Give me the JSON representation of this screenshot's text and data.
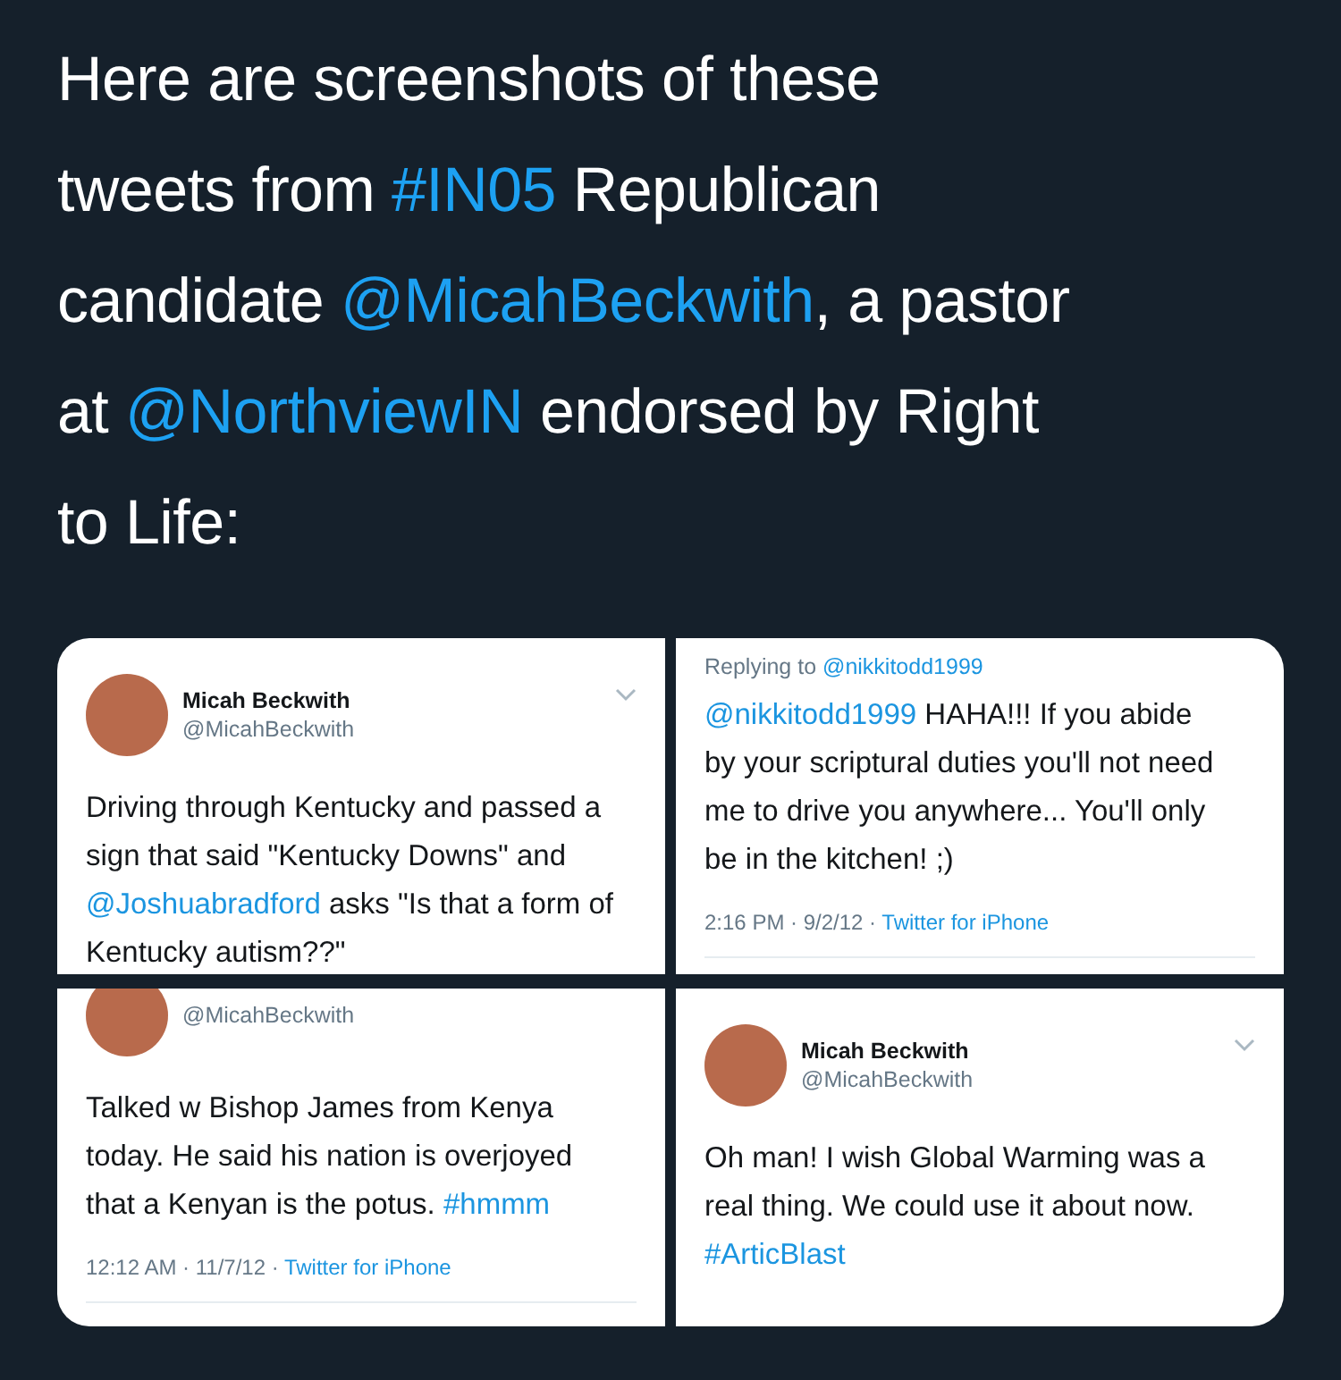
{
  "headline": {
    "lines": [
      [
        {
          "kind": "text",
          "text": "Here are screenshots of these"
        }
      ],
      [
        {
          "kind": "text",
          "text": "tweets from "
        },
        {
          "kind": "link",
          "text": "#IN05"
        },
        {
          "kind": "text",
          "text": " Republican"
        }
      ],
      [
        {
          "kind": "text",
          "text": "candidate "
        },
        {
          "kind": "link",
          "text": "@MicahBeckwith"
        },
        {
          "kind": "text",
          "text": ", a pastor"
        }
      ],
      [
        {
          "kind": "text",
          "text": "at "
        },
        {
          "kind": "link",
          "text": "@NorthviewIN"
        },
        {
          "kind": "text",
          "text": " endorsed by Right"
        }
      ],
      [
        {
          "kind": "text",
          "text": "to Life:"
        }
      ]
    ]
  },
  "media": [
    {
      "author": {
        "name": "Micah Beckwith",
        "handle": "@MicahBeckwith"
      },
      "body": [
        [
          {
            "kind": "text",
            "text": "Driving through Kentucky and passed a"
          }
        ],
        [
          {
            "kind": "text",
            "text": "sign that said \"Kentucky Downs\" and"
          }
        ],
        [
          {
            "kind": "link",
            "text": "@Joshuabradford"
          },
          {
            "kind": "text",
            "text": " asks \"Is that a form of"
          }
        ],
        [
          {
            "kind": "text",
            "text": "Kentucky autism??\""
          }
        ]
      ]
    },
    {
      "reply_to": {
        "prefix": "Replying to ",
        "handle": "@nikkitodd1999"
      },
      "body": [
        [
          {
            "kind": "link",
            "text": "@nikkitodd1999"
          },
          {
            "kind": "text",
            "text": " HAHA!!! If you abide"
          }
        ],
        [
          {
            "kind": "text",
            "text": "by your scriptural duties you'll not need"
          }
        ],
        [
          {
            "kind": "text",
            "text": "me to drive you anywhere... You'll only"
          }
        ],
        [
          {
            "kind": "text",
            "text": "be in the kitchen! ;)"
          }
        ]
      ],
      "meta": {
        "time": "2:16 PM · 9/2/12 · ",
        "source": "Twitter for iPhone"
      }
    },
    {
      "author": {
        "handle": "@MicahBeckwith"
      },
      "body": [
        [
          {
            "kind": "text",
            "text": "Talked w Bishop James from Kenya"
          }
        ],
        [
          {
            "kind": "text",
            "text": "today. He said his nation is overjoyed"
          }
        ],
        [
          {
            "kind": "text",
            "text": "that a Kenyan is the potus. "
          },
          {
            "kind": "link",
            "text": "#hmmm"
          }
        ]
      ],
      "meta": {
        "time": "12:12 AM · 11/7/12 · ",
        "source": "Twitter for iPhone"
      }
    },
    {
      "author": {
        "name": "Micah Beckwith",
        "handle": "@MicahBeckwith"
      },
      "body": [
        [
          {
            "kind": "text",
            "text": "Oh man! I wish Global Warming was a"
          }
        ],
        [
          {
            "kind": "text",
            "text": "real thing. We could use it about now."
          }
        ],
        [
          {
            "kind": "link",
            "text": "#ArticBlast"
          }
        ]
      ]
    }
  ]
}
